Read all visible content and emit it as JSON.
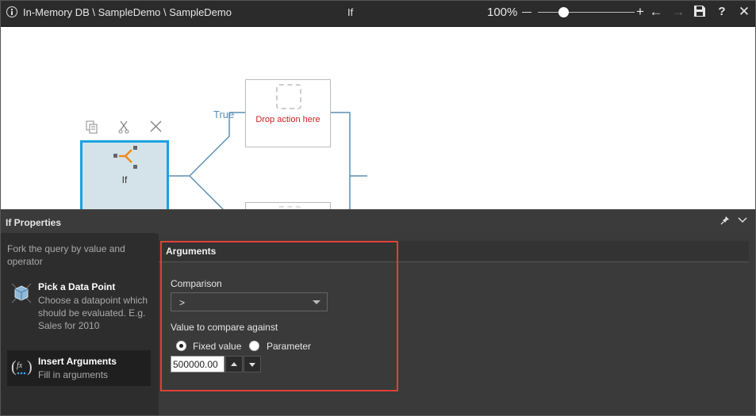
{
  "titlebar": {
    "path": "In-Memory DB \\ SampleDemo \\ SampleDemo",
    "title": "If",
    "zoom": "100%"
  },
  "toolbar_icons": [
    "info-icon",
    "zoom-out-icon",
    "zoom-in-icon",
    "back-icon",
    "forward-icon",
    "save-icon",
    "help-icon",
    "close-icon"
  ],
  "canvas": {
    "node_label": "If",
    "branch_true_label": "True",
    "drop_text": "Drop action here",
    "node_tools": [
      "copy-icon",
      "cut-icon",
      "delete-icon"
    ]
  },
  "properties": {
    "title": "If Properties",
    "description": "Fork the query by value and operator",
    "steps": [
      {
        "title": "Pick a Data Point",
        "subtitle": "Choose a datapoint which should be evaluated. E.g. Sales for 2010"
      },
      {
        "title": "Insert Arguments",
        "subtitle": "Fill in arguments"
      }
    ]
  },
  "arguments": {
    "header": "Arguments",
    "comparison_label": "Comparison",
    "comparison_value": ">",
    "compare_label": "Value to compare against",
    "radio_fixed": "Fixed value",
    "radio_param": "Parameter",
    "selected_radio": "Fixed value",
    "value": "500000.00"
  },
  "colors": {
    "accent": "#1ba1e2",
    "highlight": "#e0403a",
    "drop_text": "#cc2222",
    "branch": "#5b8fb3"
  }
}
